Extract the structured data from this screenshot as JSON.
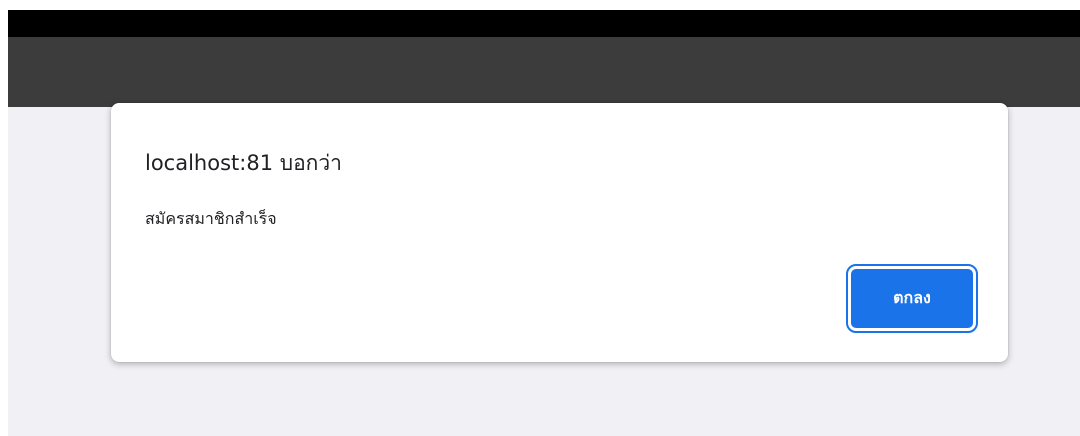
{
  "dialog": {
    "title": "localhost:81 บอกว่า",
    "message": "สมัครสมาชิกสำเร็จ",
    "ok_label": "ตกลง"
  },
  "colors": {
    "top_strip": "#000000",
    "toolbar": "#3c3c3c",
    "page_background": "#f1f1f5",
    "dialog_background": "#ffffff",
    "button_accent": "#1a73e8"
  }
}
